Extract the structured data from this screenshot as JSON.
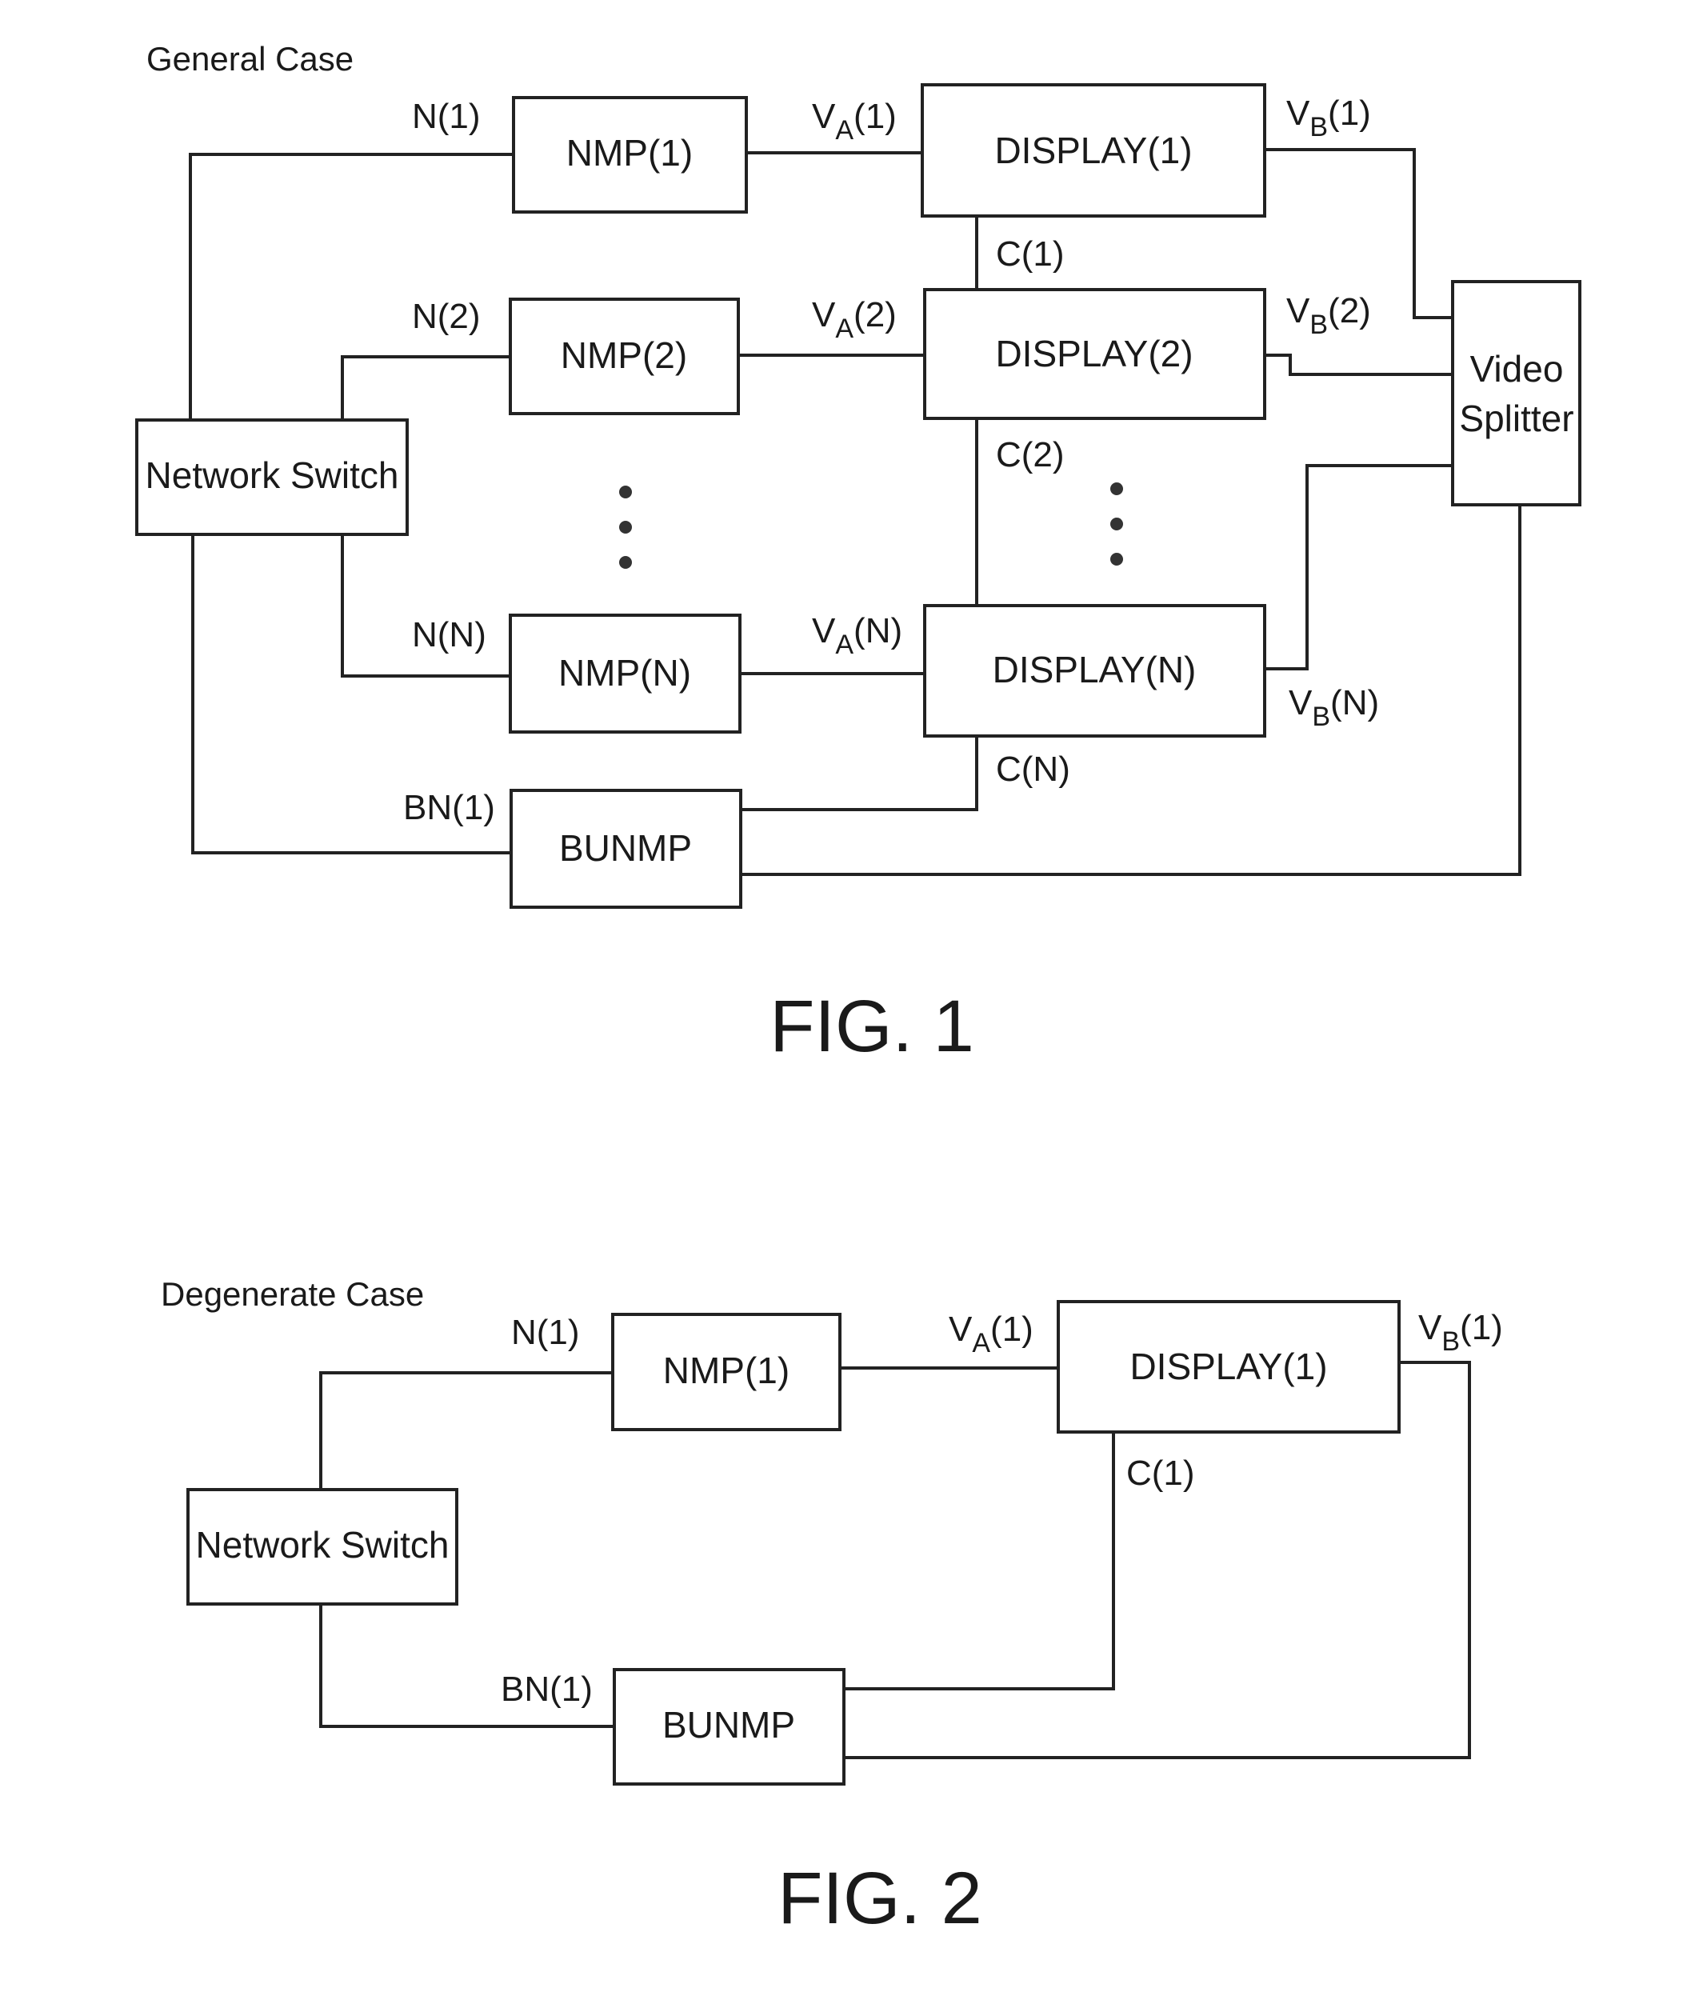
{
  "figures": [
    {
      "case_title": "General Case",
      "caption": "FIG. 1",
      "boxes": {
        "network_switch": "Network Switch",
        "nmp1": "NMP(1)",
        "nmp2": "NMP(2)",
        "nmpn": "NMP(N)",
        "bunmp": "BUNMP",
        "display1": "DISPLAY(1)",
        "display2": "DISPLAY(2)",
        "displayn": "DISPLAY(N)",
        "splitter_line1": "Video",
        "splitter_line2": "Splitter"
      },
      "signals": {
        "n1": "N(1)",
        "n2": "N(2)",
        "nn": "N(N)",
        "bn1": "BN(1)",
        "va_base": "V",
        "va_sub": "A",
        "va1_idx": "(1)",
        "va2_idx": "(2)",
        "van_idx": "(N)",
        "vb_base": "V",
        "vb_sub": "B",
        "vb1_idx": "(1)",
        "vb2_idx": "(2)",
        "vbn_idx": "(N)",
        "c1": "C(1)",
        "c2": "C(2)",
        "cn": "C(N)"
      }
    },
    {
      "case_title": "Degenerate Case",
      "caption": "FIG. 2",
      "boxes": {
        "network_switch": "Network Switch",
        "nmp1": "NMP(1)",
        "bunmp": "BUNMP",
        "display1": "DISPLAY(1)"
      },
      "signals": {
        "n1": "N(1)",
        "bn1": "BN(1)",
        "va_base": "V",
        "va_sub": "A",
        "va1_idx": "(1)",
        "vb_base": "V",
        "vb_sub": "B",
        "vb1_idx": "(1)",
        "c1": "C(1)"
      }
    }
  ]
}
